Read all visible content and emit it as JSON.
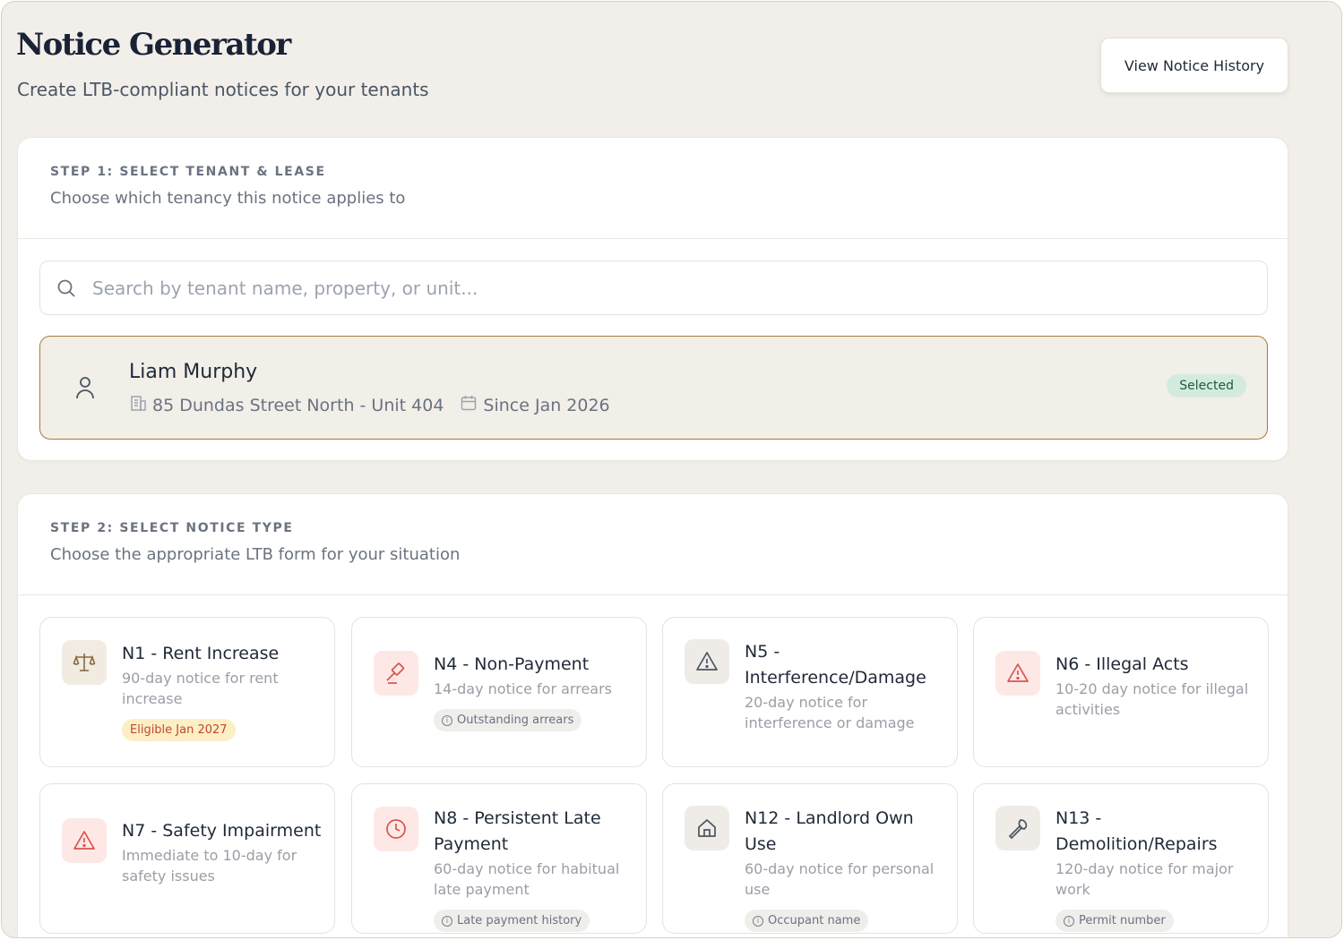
{
  "header": {
    "title": "Notice Generator",
    "subtitle": "Create LTB-compliant notices for your tenants",
    "history_button": "View Notice History"
  },
  "step1": {
    "label": "STEP 1: SELECT TENANT & LEASE",
    "description": "Choose which tenancy this notice applies to",
    "search_placeholder": "Search by tenant name, property, or unit...",
    "tenant": {
      "name": "Liam Murphy",
      "address": "85 Dundas Street North - Unit 404",
      "since": "Since Jan 2026",
      "status": "Selected"
    }
  },
  "step2": {
    "label": "STEP 2: SELECT NOTICE TYPE",
    "description": "Choose the appropriate LTB form for your situation",
    "notices": [
      {
        "title": "N1 - Rent Increase",
        "desc": "90-day notice for rent increase",
        "tag": "Eligible Jan 2027",
        "icon": "scale-icon"
      },
      {
        "title": "N4 - Non-Payment",
        "desc": "14-day notice for arrears",
        "tag": "Outstanding arrears",
        "icon": "gavel-icon"
      },
      {
        "title": "N5 - Interference/Damage",
        "desc": "20-day notice for interference or damage",
        "tag": "",
        "icon": "warning-icon"
      },
      {
        "title": "N6 - Illegal Acts",
        "desc": "10-20 day notice for illegal activities",
        "tag": "",
        "icon": "alert-icon"
      },
      {
        "title": "N7 - Safety Impairment",
        "desc": "Immediate to 10-day for safety issues",
        "tag": "",
        "icon": "alert-icon"
      },
      {
        "title": "N8 - Persistent Late Payment",
        "desc": "60-day notice for habitual late payment",
        "tag": "Late payment history",
        "icon": "clock-icon"
      },
      {
        "title": "N12 - Landlord Own Use",
        "desc": "60-day notice for personal use",
        "tag": "Occupant name",
        "icon": "home-icon"
      },
      {
        "title": "N13 - Demolition/Repairs",
        "desc": "120-day notice for major work",
        "tag": "Permit number",
        "icon": "wrench-icon"
      }
    ]
  }
}
